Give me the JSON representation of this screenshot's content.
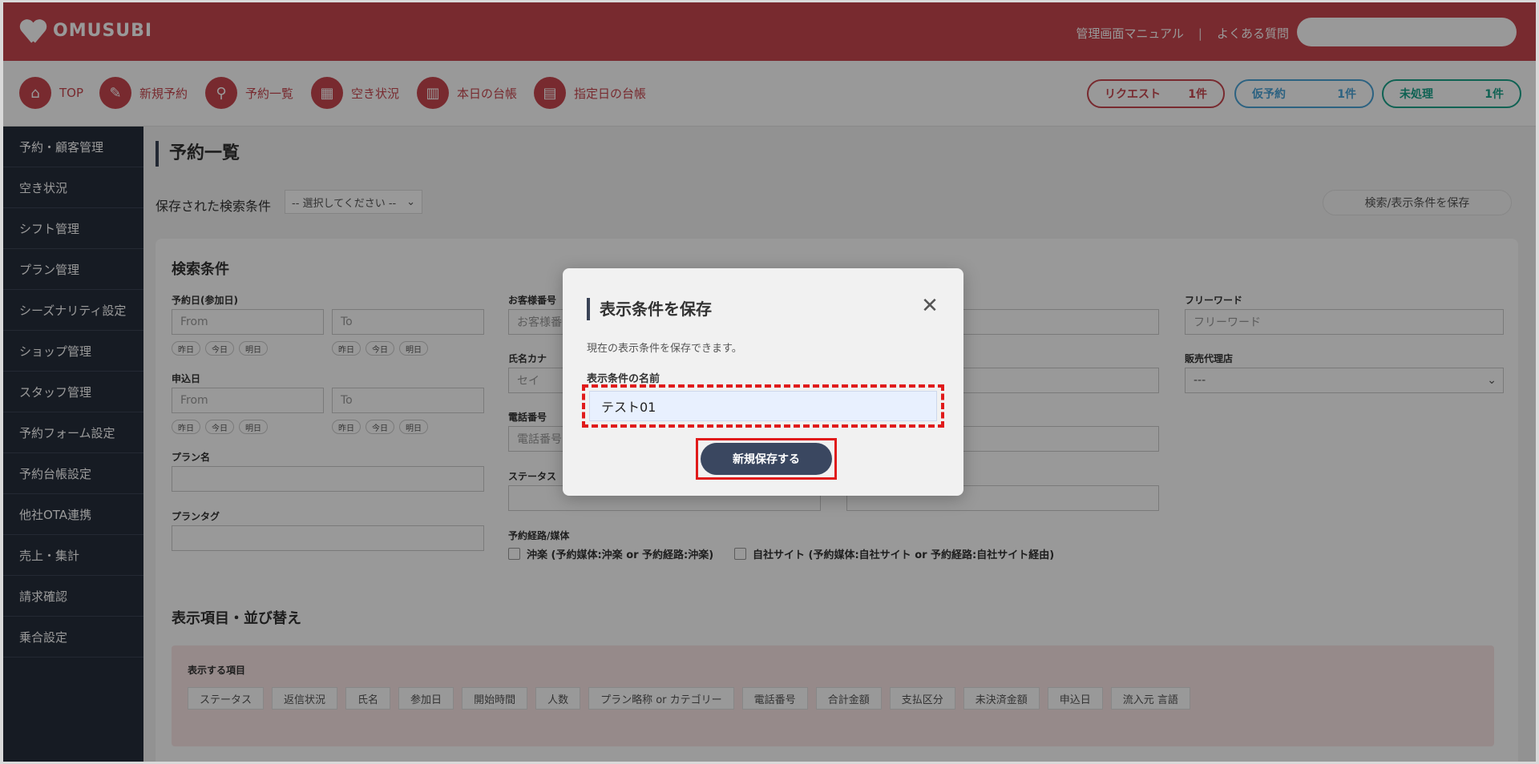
{
  "header": {
    "logo_text": "OMUSUBI",
    "links": [
      "管理画面マニュアル",
      "よくある質問"
    ],
    "link_separator": "|"
  },
  "nav": {
    "items": [
      {
        "label": "TOP",
        "icon": "home-icon"
      },
      {
        "label": "新規予約",
        "icon": "edit-icon"
      },
      {
        "label": "予約一覧",
        "icon": "search-icon"
      },
      {
        "label": "空き状況",
        "icon": "grid-icon"
      },
      {
        "label": "本日の台帳",
        "icon": "book-icon"
      },
      {
        "label": "指定日の台帳",
        "icon": "calendar-icon"
      }
    ],
    "pills": [
      {
        "label": "リクエスト",
        "count": "1件"
      },
      {
        "label": "仮予約",
        "count": "1件"
      },
      {
        "label": "未処理",
        "count": "1件"
      }
    ]
  },
  "sidebar": {
    "items": [
      {
        "label": "予約・顧客管理"
      },
      {
        "label": "空き状況"
      },
      {
        "label": "シフト管理"
      },
      {
        "label": "プラン管理"
      },
      {
        "label": "シーズナリティ設定"
      },
      {
        "label": "ショップ管理"
      },
      {
        "label": "スタッフ管理"
      },
      {
        "label": "予約フォーム設定"
      },
      {
        "label": "予約台帳設定"
      },
      {
        "label": "他社OTA連携"
      },
      {
        "label": "売上・集計"
      },
      {
        "label": "請求確認"
      },
      {
        "label": "乗合設定"
      }
    ]
  },
  "main": {
    "title": "予約一覧",
    "saved_conditions_label": "保存された検索条件",
    "saved_conditions_select": "-- 選択してください --",
    "save_conditions_button": "検索/表示条件を保存",
    "search": {
      "title": "検索条件",
      "reservation_date_label": "予約日(参加日)",
      "from_placeholder": "From",
      "to_placeholder": "To",
      "quick_chips": [
        "昨日",
        "今日",
        "明日"
      ],
      "application_date_label": "申込日",
      "plan_name_label": "プラン名",
      "plan_tag_label": "プランタグ",
      "customer_number_label": "お客様番号",
      "customer_number_placeholder": "お客様番号",
      "name_kana_label": "氏名カナ",
      "name_kana_placeholder": "セイ",
      "phone_label": "電話番号",
      "phone_placeholder": "電話番号",
      "status_label": "ステータス",
      "route_label": "予約経路/媒体",
      "route_options": [
        "沖楽 (予約媒体:沖楽 or 予約経路:沖楽)",
        "自社サイト (予約媒体:自社サイト or 予約経路:自社サイト経由)"
      ],
      "free_word_label": "フリーワード",
      "free_word_placeholder": "フリーワード",
      "agency_label": "販売代理店",
      "agency_select": "---"
    },
    "display": {
      "title": "表示項目・並び替え",
      "items_label": "表示する項目",
      "items": [
        "ステータス",
        "返信状況",
        "氏名",
        "参加日",
        "開始時間",
        "人数",
        "プラン略称 or カテゴリー",
        "電話番号",
        "合計金額",
        "支払区分",
        "未決済金額",
        "申込日",
        "流入元 言語"
      ]
    }
  },
  "modal": {
    "title": "表示条件を保存",
    "description": "現在の表示条件を保存できます。",
    "name_label": "表示条件の名前",
    "name_value": "テスト01",
    "save_button": "新規保存する",
    "close_glyph": "✕"
  }
}
